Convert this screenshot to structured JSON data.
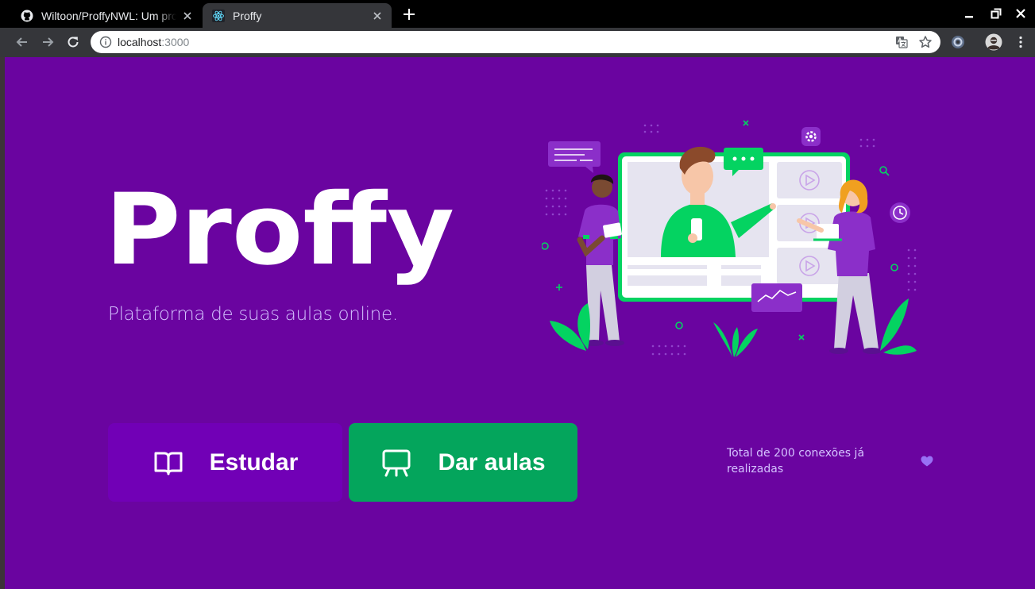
{
  "browser": {
    "tabs": [
      {
        "title": "Wiltoon/ProffyNWL: Um projeto",
        "favicon": "github-icon",
        "active": false
      },
      {
        "title": "Proffy",
        "favicon": "react-icon",
        "active": true
      }
    ],
    "address": {
      "host": "localhost",
      "port": ":3000"
    }
  },
  "landing": {
    "logo_text": "Proffy",
    "tagline": "Plataforma de suas aulas online.",
    "buttons": {
      "study": {
        "label": "Estudar",
        "icon": "book-open-icon"
      },
      "teach": {
        "label": "Dar aulas",
        "icon": "presentation-board-icon"
      }
    },
    "total_connections": "Total de 200 conexões já realizadas",
    "heart_icon": "purple-heart-icon"
  },
  "colors": {
    "background": "#6a04a0",
    "study_button": "#7100b6",
    "teach_button": "#04a55c",
    "text_light": "#d4c2ff",
    "accent_green": "#04d361"
  }
}
